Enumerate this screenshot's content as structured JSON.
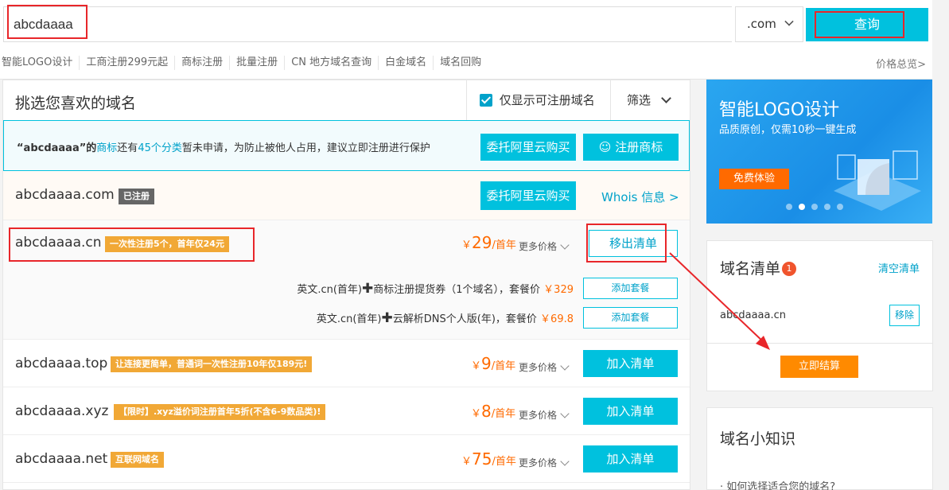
{
  "search": {
    "value": "abcdaaaa",
    "tld": ".com",
    "query_label": "查询"
  },
  "quick_links": [
    "智能LOGO设计",
    "工商注册299元起",
    "商标注册",
    "批量注册",
    "CN 地方域名查询",
    "白金域名",
    "域名回购"
  ],
  "price_overview": "价格总览>",
  "list": {
    "title": "挑选您喜欢的域名",
    "only_available": "仅显示可注册域名",
    "filter": "筛选"
  },
  "trademark_tip": {
    "prefix": "“abcdaaaa”的",
    "link1": "商标",
    "mid": "还有",
    "link2": "45个分类",
    "suffix": "暂未申请，为防止被他人占用，建议立即注册进行保护",
    "buy_btn": "委托阿里云购买",
    "reg_btn": "注册商标"
  },
  "rows": {
    "com": {
      "name": "abcdaaaa.com",
      "tag": "已注册",
      "buy_btn": "委托阿里云购买",
      "whois": "Whois 信息 >"
    },
    "cn": {
      "name": "abcdaaaa.cn",
      "tag": "一次性注册5个，首年仅24元",
      "currency": "￥",
      "price": "29",
      "unit": "/首年",
      "more": "更多价格",
      "action": "移出清单",
      "packages": [
        {
          "prefix": "英文.cn(首年)",
          "desc": "商标注册提货券（1个域名），套餐价",
          "price": "￥329",
          "btn": "添加套餐"
        },
        {
          "prefix": "英文.cn(首年)",
          "desc": "云解析DNS个人版(年)，套餐价",
          "price": "￥69.8",
          "btn": "添加套餐"
        }
      ]
    },
    "top": {
      "name": "abcdaaaa.top",
      "tag": "让连接更简单，普通词一次性注册10年仅189元!",
      "currency": "￥",
      "price": "9",
      "unit": "/首年",
      "more": "更多价格",
      "action": "加入清单"
    },
    "xyz": {
      "name": "abcdaaaa.xyz",
      "tag": "【限时】.xyz溢价词注册首年5折(不含6-9数品类)!",
      "currency": "￥",
      "price": "8",
      "unit": "/首年",
      "more": "更多价格",
      "action": "加入清单"
    },
    "net": {
      "name": "abcdaaaa.net",
      "tag": "互联网域名",
      "currency": "￥",
      "price": "75",
      "unit": "/首年",
      "more": "更多价格",
      "action": "加入清单"
    }
  },
  "banner": {
    "title": "智能LOGO设计",
    "subtitle": "品质原创，仅需10秒一键生成",
    "cta": "免费体验"
  },
  "cart": {
    "title": "域名清单",
    "count": "1",
    "clear": "清空清单",
    "item": "abcdaaaa.cn",
    "remove": "移除",
    "checkout": "立即结算"
  },
  "tips": {
    "title": "域名小知识",
    "item": "· 如何选择适合您的域名?"
  },
  "colors": {
    "accent": "#00c1de",
    "price": "#ff6a00",
    "annotation": "#e8262a"
  }
}
